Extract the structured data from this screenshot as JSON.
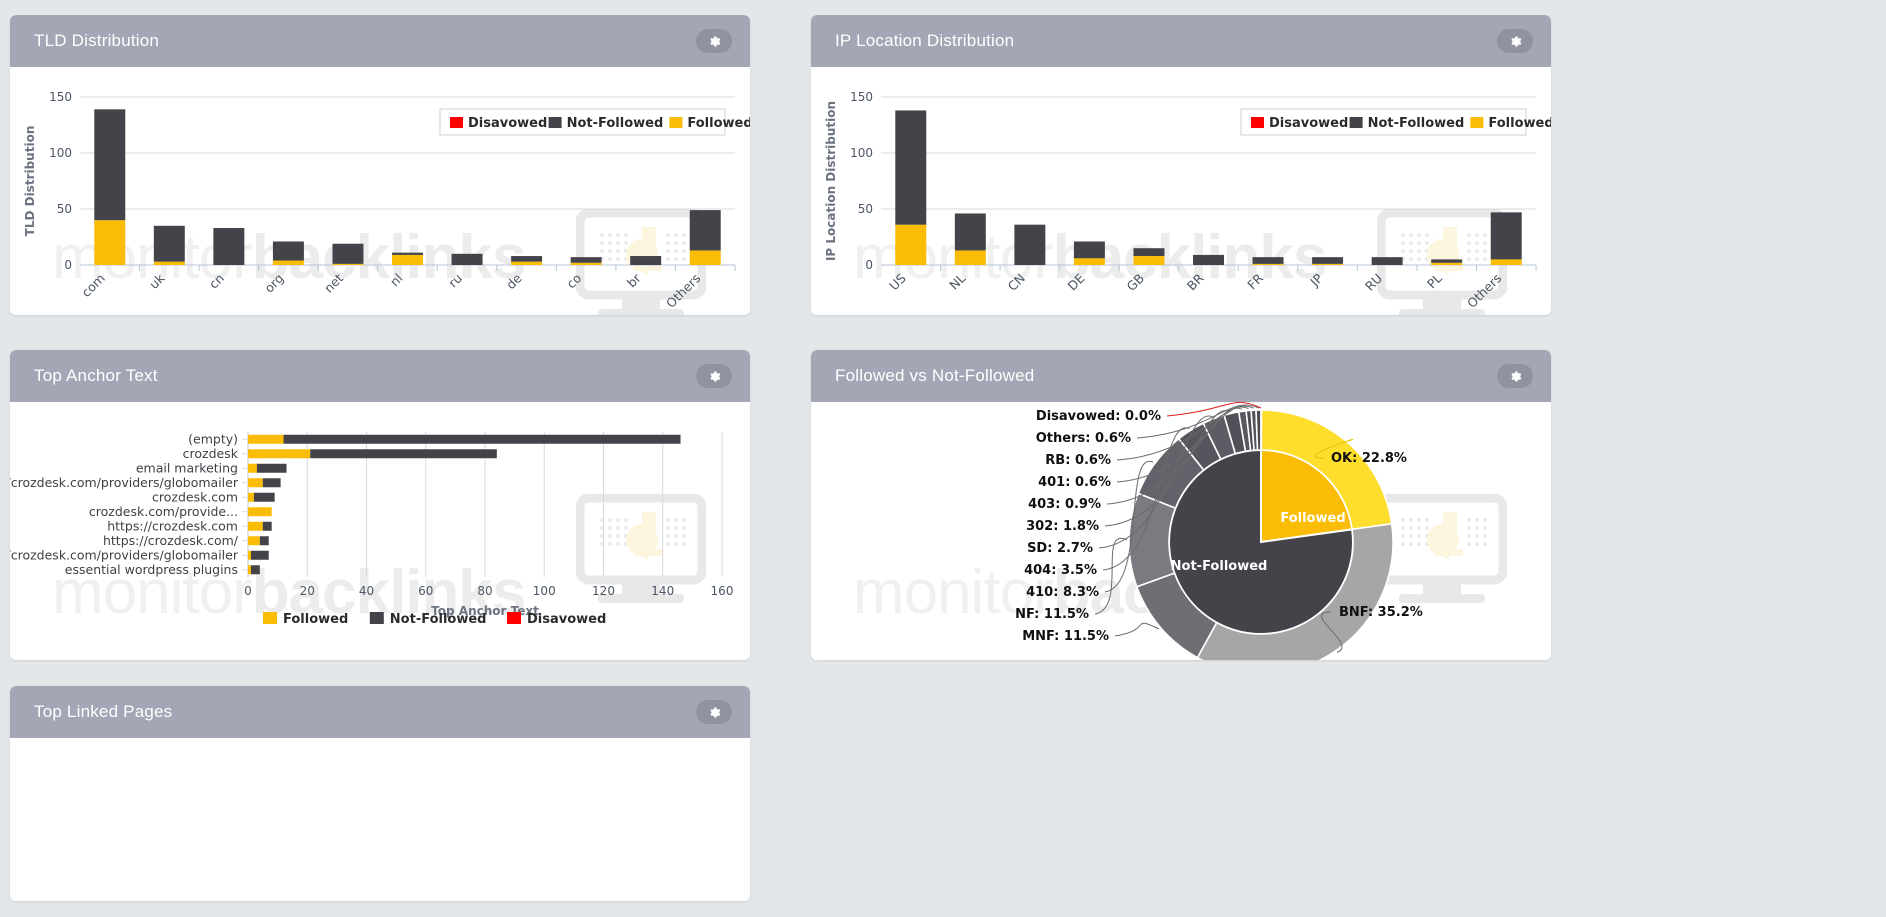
{
  "colors": {
    "followed": "#fbbc05",
    "followed_light": "#ffdd2d",
    "not_followed": "#434349",
    "not_followed_light": "#6e6e74",
    "disavowed": "#ff0000",
    "panel_header": "#a3a6b4",
    "page_bg": "#e4e7ea"
  },
  "watermark": {
    "thin": "monitor",
    "bold": "backlinks"
  },
  "panels": [
    {
      "id": "tld",
      "title": "TLD Distribution",
      "gear_icon": "gear-icon"
    },
    {
      "id": "ip",
      "title": "IP Location Distribution",
      "gear_icon": "gear-icon"
    },
    {
      "id": "anchor",
      "title": "Top Anchor Text",
      "gear_icon": "gear-icon"
    },
    {
      "id": "followed",
      "title": "Followed vs Not-Followed",
      "gear_icon": "gear-icon"
    },
    {
      "id": "linked",
      "title": "Top Linked Pages",
      "gear_icon": "gear-icon"
    }
  ],
  "legend": {
    "disavowed": "Disavowed",
    "not_followed": "Not-Followed",
    "followed": "Followed"
  },
  "chart_data": [
    {
      "id": "tld",
      "type": "bar",
      "stacked": true,
      "title": "TLD Distribution",
      "xlabel": "",
      "ylabel": "TLD Distribution",
      "ylim": [
        0,
        150
      ],
      "yticks": [
        0,
        50,
        100,
        150
      ],
      "grid": true,
      "legend_position": "top-right",
      "categories": [
        "com",
        "uk",
        "cn",
        "org",
        "net",
        "nl",
        "ru",
        "de",
        "co",
        "br",
        "Others"
      ],
      "series": [
        {
          "name": "Followed",
          "color": "#fbbc05",
          "values": [
            40,
            3,
            0,
            4,
            1,
            9,
            0,
            3,
            2,
            0,
            13
          ]
        },
        {
          "name": "Not-Followed",
          "color": "#434349",
          "values": [
            99,
            32,
            33,
            17,
            18,
            2,
            10,
            5,
            5,
            8,
            36
          ]
        },
        {
          "name": "Disavowed",
          "color": "#ff0000",
          "values": [
            0,
            0,
            0,
            0,
            0,
            0,
            0,
            0,
            0,
            0,
            0
          ]
        }
      ]
    },
    {
      "id": "ip",
      "type": "bar",
      "stacked": true,
      "title": "IP Location Distribution",
      "xlabel": "",
      "ylabel": "IP Location Distribution",
      "ylim": [
        0,
        150
      ],
      "yticks": [
        0,
        50,
        100,
        150
      ],
      "grid": true,
      "legend_position": "top-right",
      "categories": [
        "US",
        "NL",
        "CN",
        "DE",
        "GB",
        "BR",
        "FR",
        "JP",
        "RU",
        "PL",
        "Others"
      ],
      "series": [
        {
          "name": "Followed",
          "color": "#fbbc05",
          "values": [
            36,
            13,
            0,
            6,
            8,
            0,
            1,
            1,
            0,
            2,
            5
          ]
        },
        {
          "name": "Not-Followed",
          "color": "#434349",
          "values": [
            102,
            33,
            36,
            15,
            7,
            9,
            6,
            6,
            7,
            3,
            42
          ]
        },
        {
          "name": "Disavowed",
          "color": "#ff0000",
          "values": [
            0,
            0,
            0,
            0,
            0,
            0,
            0,
            0,
            0,
            0,
            0
          ]
        }
      ]
    },
    {
      "id": "anchor",
      "type": "bar",
      "orientation": "horizontal",
      "stacked": true,
      "title": "Top Anchor Text",
      "xlabel": "Top Anchor Text",
      "ylabel": "",
      "xlim": [
        0,
        160
      ],
      "xticks": [
        0,
        20,
        40,
        60,
        80,
        100,
        120,
        140,
        160
      ],
      "grid": true,
      "legend_position": "bottom",
      "categories": [
        "(empty)",
        "crozdesk",
        "email marketing",
        "https://crozdesk.com/providers/globomailer",
        "crozdesk.com",
        "crozdesk.com/provide...",
        "https://crozdesk.com",
        "https://crozdesk.com/",
        "http://crozdesk.com/providers/globomailer",
        "essential wordpress plugins"
      ],
      "series": [
        {
          "name": "Followed",
          "color": "#fbbc05",
          "values": [
            12,
            21,
            3,
            5,
            2,
            8,
            5,
            4,
            1,
            1
          ]
        },
        {
          "name": "Not-Followed",
          "color": "#434349",
          "values": [
            134,
            63,
            10,
            6,
            7,
            0,
            3,
            3,
            6,
            3
          ]
        },
        {
          "name": "Disavowed",
          "color": "#ff0000",
          "values": [
            0,
            0,
            0,
            0,
            0,
            0,
            0,
            0,
            0,
            0
          ]
        }
      ]
    },
    {
      "id": "followed",
      "type": "pie",
      "title": "Followed vs Not-Followed",
      "inner_ring": [
        {
          "name": "Followed",
          "value": 22.8,
          "color": "#fbbc05"
        },
        {
          "name": "Not-Followed",
          "value": 77.2,
          "color": "#434349"
        }
      ],
      "outer_ring": [
        {
          "label": "OK: 22.8%",
          "name": "OK",
          "value": 22.8,
          "color": "#ffdd2d"
        },
        {
          "label": "BNF: 35.2%",
          "name": "BNF",
          "value": 35.2,
          "color": "#a6a6a6"
        },
        {
          "label": "MNF: 11.5%",
          "name": "MNF",
          "value": 11.5,
          "color": "#6e6e74"
        },
        {
          "label": "NF: 11.5%",
          "name": "NF",
          "value": 11.5,
          "color": "#7a7a80"
        },
        {
          "label": "410: 8.3%",
          "name": "410",
          "value": 8.3,
          "color": "#62626a"
        },
        {
          "label": "404: 3.5%",
          "name": "404",
          "value": 3.5,
          "color": "#55555d"
        },
        {
          "label": "SD: 2.7%",
          "name": "SD",
          "value": 2.7,
          "color": "#5c5c64"
        },
        {
          "label": "302: 1.8%",
          "name": "302",
          "value": 1.8,
          "color": "#505058"
        },
        {
          "label": "403: 0.9%",
          "name": "403",
          "value": 0.9,
          "color": "#595961"
        },
        {
          "label": "401: 0.6%",
          "name": "401",
          "value": 0.6,
          "color": "#4d4d55"
        },
        {
          "label": "RB: 0.6%",
          "name": "RB",
          "value": 0.6,
          "color": "#56565e"
        },
        {
          "label": "Others: 0.6%",
          "name": "Others",
          "value": 0.6,
          "color": "#4a4a52"
        },
        {
          "label": "Disavowed: 0.0%",
          "name": "Disavowed",
          "value": 0.0,
          "color": "#ff0000"
        }
      ],
      "center_labels": [
        {
          "text": "Followed",
          "color": "#ffffff"
        },
        {
          "text": "Not-Followed",
          "color": "#ffffff"
        }
      ]
    }
  ]
}
